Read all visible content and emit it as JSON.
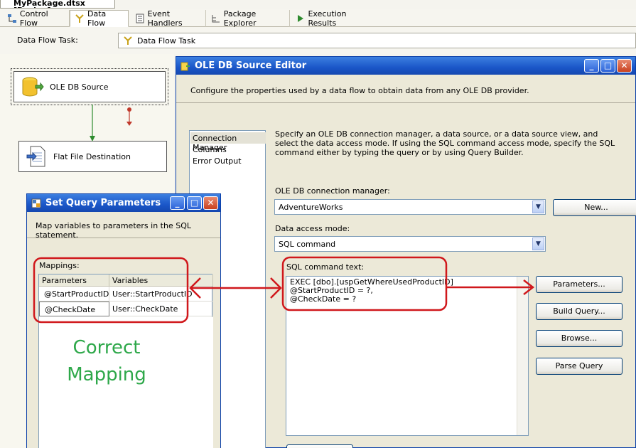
{
  "document": {
    "tab_title": "MyPackage.dtsx [Design]"
  },
  "designer_tabs": [
    {
      "label": "Control Flow",
      "icon": "control-flow-icon"
    },
    {
      "label": "Data Flow",
      "icon": "data-flow-icon"
    },
    {
      "label": "Event Handlers",
      "icon": "event-handlers-icon"
    },
    {
      "label": "Package Explorer",
      "icon": "package-explorer-icon"
    },
    {
      "label": "Execution Results",
      "icon": "execution-results-icon"
    }
  ],
  "task_row": {
    "label": "Data Flow Task:",
    "value": "Data Flow Task"
  },
  "components": {
    "source": "OLE DB Source",
    "destination": "Flat File Destination"
  },
  "ole_editor": {
    "title": "OLE DB Source Editor",
    "description": "Configure the properties used by a data flow to obtain data from any OLE DB provider.",
    "nav": [
      "Connection Manager",
      "Columns",
      "Error Output"
    ],
    "info": "Specify an OLE DB connection manager, a data source, or a data source view, and select the data access mode. If using the SQL command access mode, specify the SQL command either by typing the query or by using Query Builder.",
    "connection_label": "OLE DB connection manager:",
    "connection_value": "AdventureWorks",
    "access_mode_label": "Data access mode:",
    "access_mode_value": "SQL command",
    "sql_label": "SQL command text:",
    "sql_text": "EXEC [dbo].[uspGetWhereUsedProductID]\n@StartProductID = ?,\n@CheckDate = ?",
    "buttons": {
      "new": "New...",
      "parameters": "Parameters...",
      "build_query": "Build Query...",
      "browse": "Browse...",
      "parse_query": "Parse Query"
    }
  },
  "query_params": {
    "title": "Set Query Parameters",
    "description": "Map variables to parameters in the SQL statement.",
    "mappings_label": "Mappings:",
    "columns": [
      "Parameters",
      "Variables"
    ],
    "rows": [
      {
        "parameter": "@StartProductID",
        "variable": "User::StartProductID"
      },
      {
        "parameter": "@CheckDate",
        "variable": "User::CheckDate"
      }
    ]
  },
  "annotation": {
    "line1": "Correct",
    "line2": "Mapping"
  },
  "colors": {
    "annotation_red": "#d0181c",
    "annotation_green": "#2ea84a",
    "titlebar_blue": "#1a56c8"
  }
}
